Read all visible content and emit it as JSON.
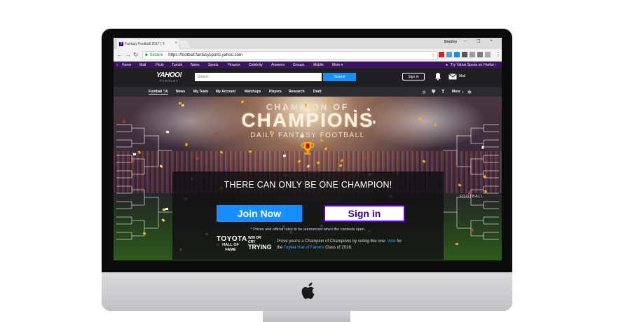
{
  "browser": {
    "tab_title": "Fantasy Football 2017 | Y",
    "tab_favicon": "Y",
    "close_glyph": "×",
    "profile_name": "Bradley",
    "window_controls": [
      "–",
      "❐",
      "×"
    ],
    "nav": {
      "back": "←",
      "forward": "→",
      "reload": "↻"
    },
    "secure_label": "Secure",
    "separator": "|",
    "url": "https://football.fantasysports.yahoo.com",
    "bookmark_icon": "star-icon",
    "bookmark_glyph": "☆",
    "kebab_glyph": "⋮",
    "extension_colors": [
      "#c62828",
      "#5c9ad6",
      "#1e88e5",
      "#555555",
      "#9e9e9e",
      "#7d7d7d",
      "#aaaaaa"
    ]
  },
  "yahoo_nav": {
    "items": [
      "Home",
      "Mail",
      "Flickr",
      "Tumblr",
      "News",
      "Sports",
      "Finance",
      "Celebrity",
      "Answers",
      "Groups",
      "Mobile",
      "More ▾"
    ],
    "promo": "Try Yahoo Sports on Firefox ›"
  },
  "header": {
    "logo": "YAHOO!",
    "logo_sub": "FANTASY",
    "search_placeholder": "Search",
    "search_button": "Search",
    "signin": "Sign in",
    "mail_label": "Mail"
  },
  "fantasy_nav": {
    "items": [
      "Football '16",
      "News",
      "My Team",
      "My Account",
      "Matchups",
      "Players",
      "Research",
      "Draft"
    ],
    "more": "More ⌄",
    "icons": [
      "star-icon",
      "team-logo-icon",
      "team-logo-icon-2",
      "gear-icon"
    ]
  },
  "hero": {
    "line1": "CHAMPION OF",
    "line2": "CHAMPIONS",
    "line3": "DAILY FANTASY FOOTBALL",
    "tagline": "THERE CAN ONLY BE ONE CHAMPION!",
    "join_button": "Join Now",
    "signin_button": "Sign in",
    "disclaimer": "* Prizes and official rules to be announced when the contests open.",
    "toyota_line1": "TOYOTA",
    "toyota_line2": "HALL OF FAME",
    "hof_line1": "WIN OR CRY",
    "hof_line2": "TRYING",
    "vote_text_1": "Prove you're a Champion of Champions by voting like one. ",
    "vote_link": "Vote",
    "vote_text_2": " for the ",
    "vote_link_2": "Toyota Hall of Fame's",
    "vote_text_3": " Class of 2016.",
    "football_sign": "FOOTBALL"
  },
  "colors": {
    "yahoo_purple": "#3c1361",
    "accent_blue": "#188fff",
    "signin_border": "#6001d2"
  }
}
